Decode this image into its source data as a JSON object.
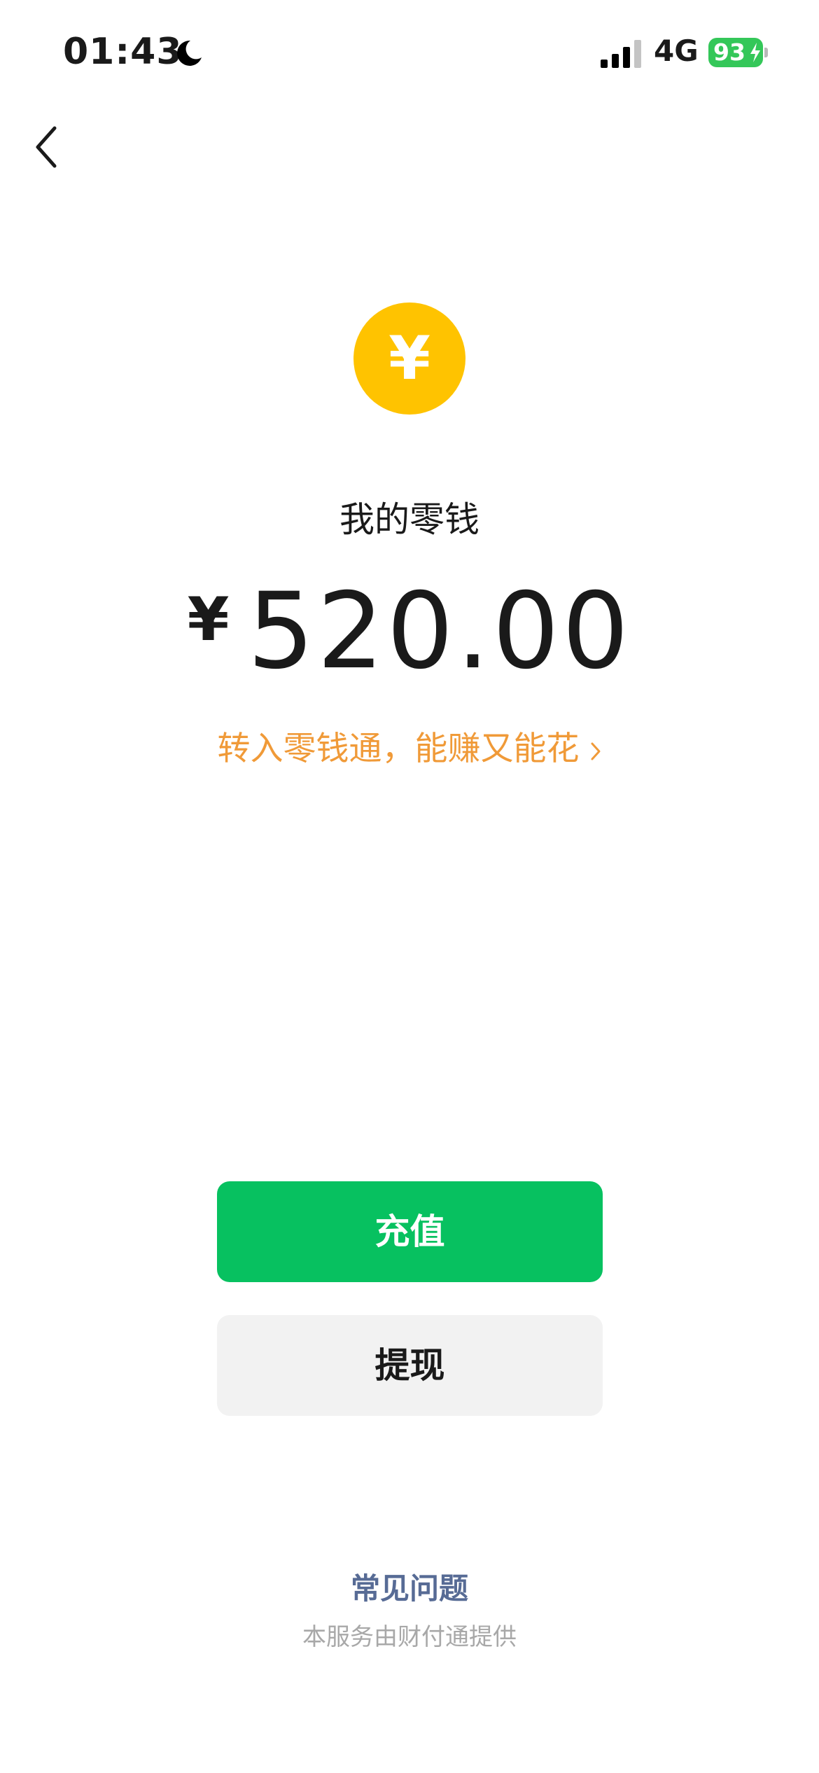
{
  "status_bar": {
    "time": "01:43",
    "network": "4G",
    "battery_level": "93",
    "icons": [
      "moon-icon",
      "signal-icon",
      "charging-bolt-icon"
    ]
  },
  "nav": {
    "back_icon": "chevron-left-icon"
  },
  "wallet": {
    "coin_symbol": "¥",
    "title": "我的零钱",
    "currency": "¥",
    "amount": "520.00",
    "promo_text": "转入零钱通，能赚又能花"
  },
  "actions": {
    "topup_label": "充值",
    "withdraw_label": "提现"
  },
  "footer": {
    "faq_label": "常见问题",
    "provider_text": "本服务由财付通提供"
  },
  "colors": {
    "coin": "#ffc300",
    "primary_button": "#07c160",
    "secondary_button": "#f2f2f2",
    "promo": "#f09a38",
    "link": "#576b95",
    "battery": "#34c759"
  }
}
